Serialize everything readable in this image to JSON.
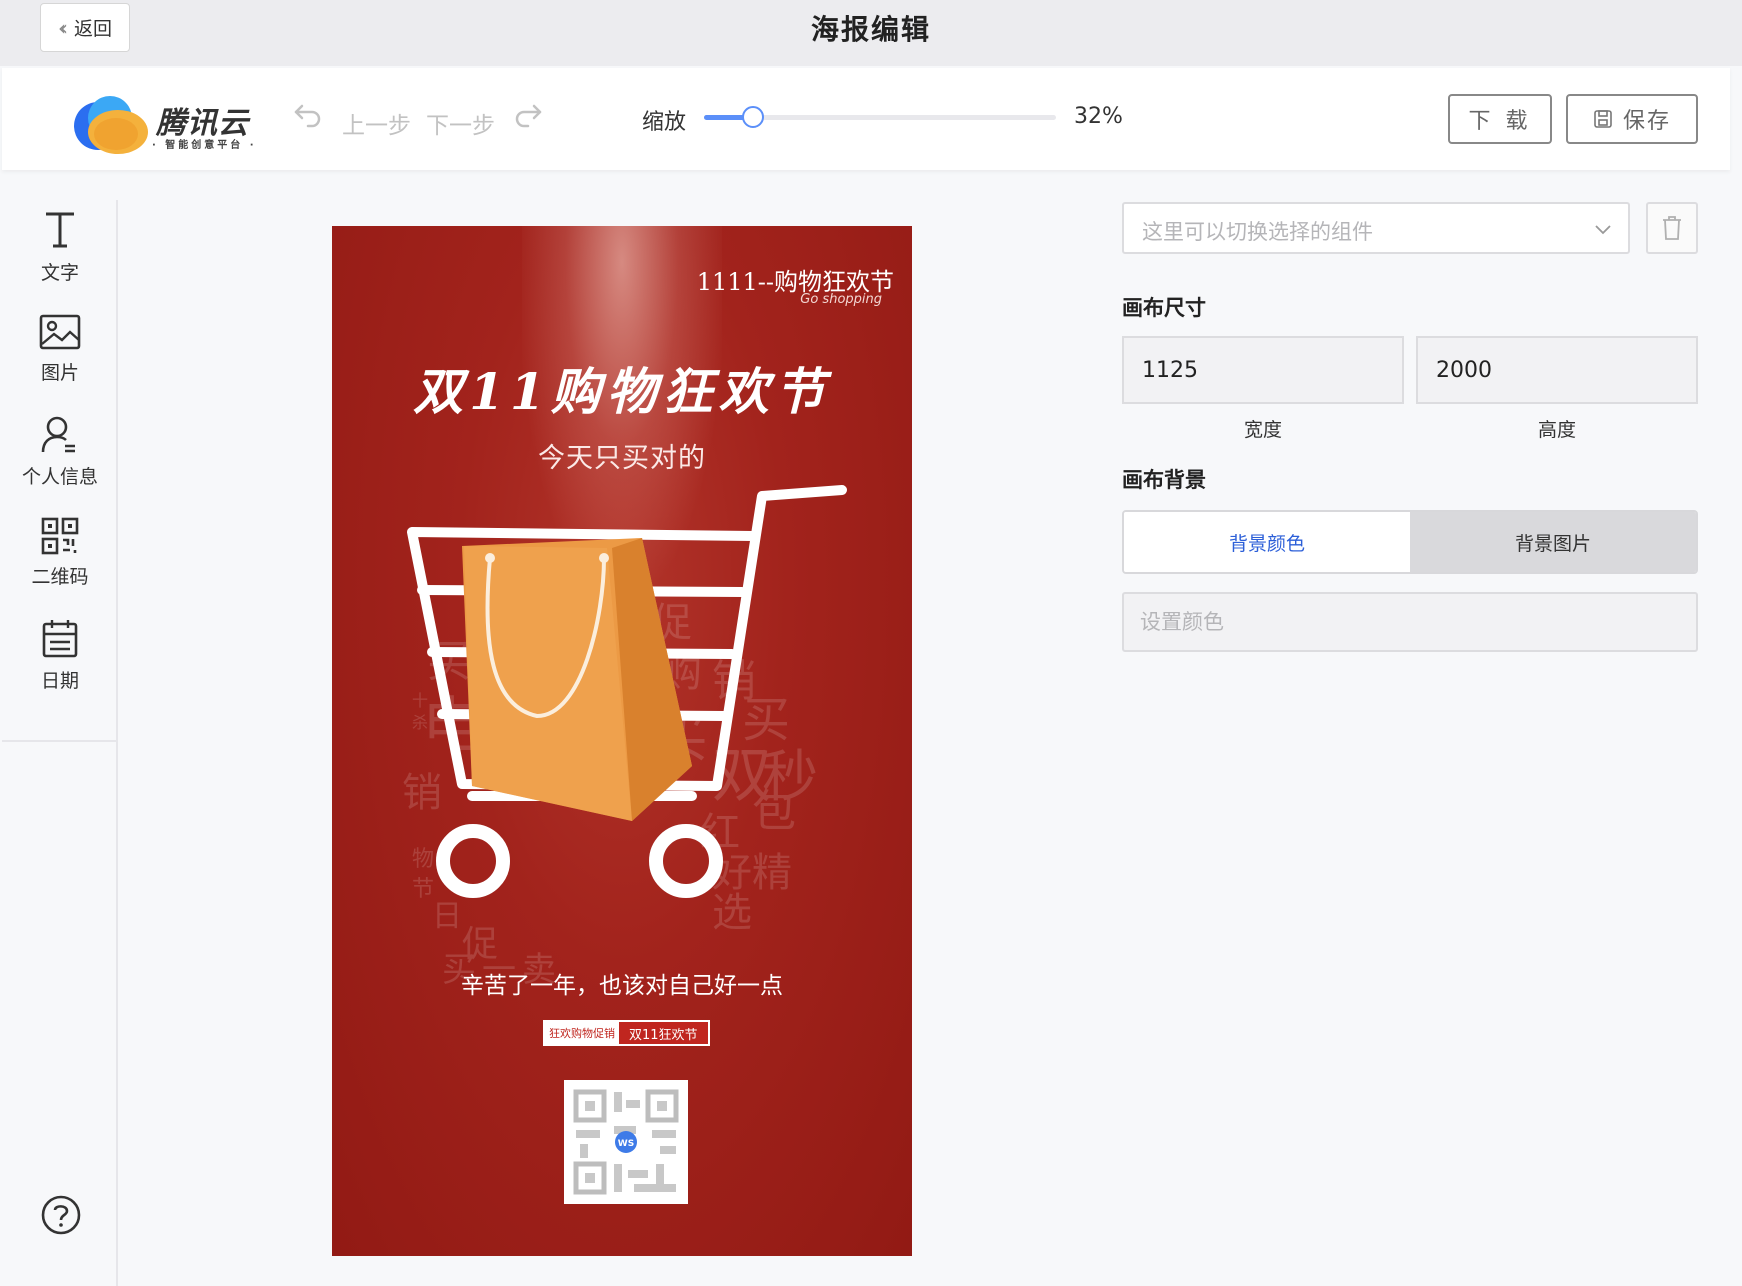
{
  "header": {
    "back_label": "返回",
    "title": "海报编辑"
  },
  "toolbar": {
    "logo_name": "腾讯云",
    "logo_tagline": "· 智能创意平台 ·",
    "undo_label": "上一步",
    "redo_label": "下一步",
    "zoom_label": "缩放",
    "zoom_value": "32%",
    "zoom_fraction": 0.14,
    "download_label": "下 载",
    "save_label": "保存"
  },
  "sidebar": {
    "tools": [
      {
        "label": "文字",
        "icon": "text-icon"
      },
      {
        "label": "图片",
        "icon": "image-icon"
      },
      {
        "label": "个人信息",
        "icon": "user-icon"
      },
      {
        "label": "二维码",
        "icon": "qrcode-icon"
      },
      {
        "label": "日期",
        "icon": "calendar-icon"
      }
    ],
    "help_icon": "help-icon"
  },
  "poster": {
    "top_text": "1111--购物狂欢节",
    "top_subtext": "Go shopping",
    "title": "双11购物狂欢节",
    "subtitle": "今天只买对的",
    "slogan": "辛苦了一年，也该对自己好一点",
    "tag_left": "狂欢购物促销",
    "tag_right": "双11狂欢节",
    "qr_badge": "WS",
    "background_color": "#a2231c",
    "bag_color": "#ec9a45",
    "word_cloud": [
      "秒",
      "买",
      "杀",
      "电",
      "商",
      "促",
      "购",
      "销",
      "买",
      "买",
      "双",
      "秒",
      "十",
      "杀",
      "红",
      "包",
      "好",
      "精",
      "选",
      "物",
      "节",
      "日",
      "促",
      "销",
      "买",
      "一",
      "卖"
    ]
  },
  "panel": {
    "component_placeholder": "这里可以切换选择的组件",
    "canvas_size_title": "画布尺寸",
    "width_value": "1125",
    "height_value": "2000",
    "width_label": "宽度",
    "height_label": "高度",
    "canvas_bg_title": "画布背景",
    "bg_color_tab": "背景颜色",
    "bg_image_tab": "背景图片",
    "color_placeholder": "设置颜色"
  }
}
